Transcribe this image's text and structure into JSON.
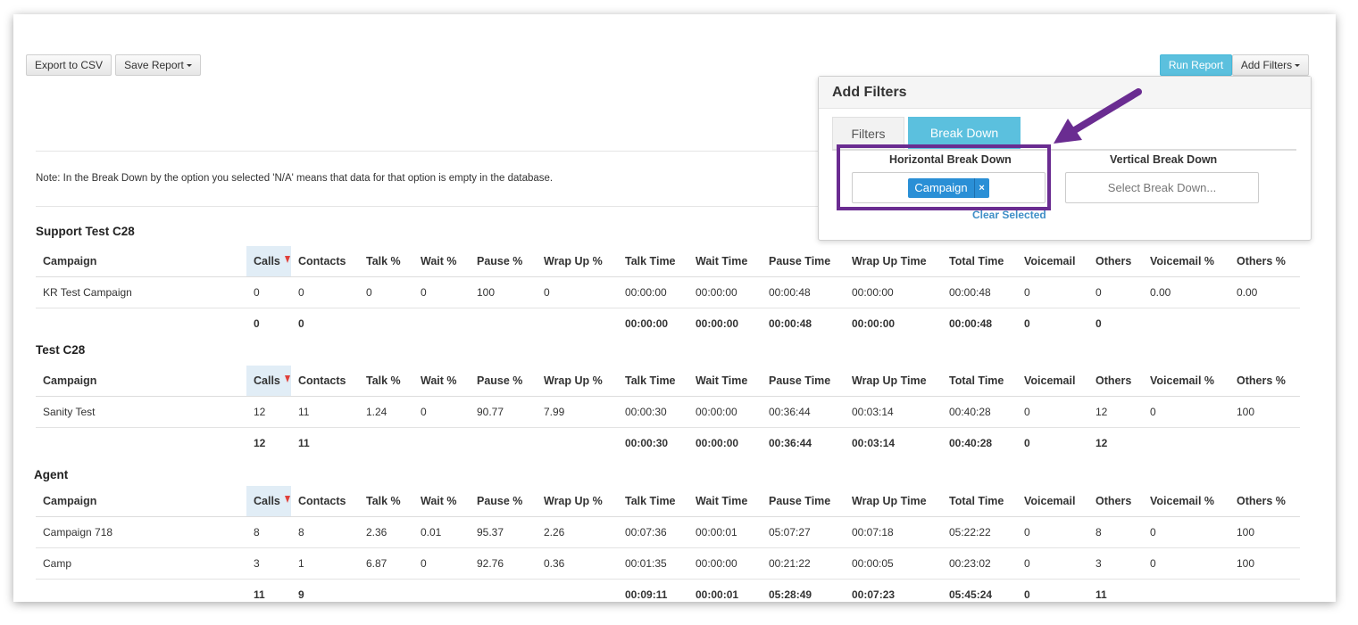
{
  "toolbar": {
    "export_label": "Export to CSV",
    "save_label": "Save Report",
    "run_label": "Run Report",
    "add_filters_label": "Add Filters"
  },
  "note": "Note: In the Break Down by the option you selected 'N/A' means that data for that option is empty in the database.",
  "columns": [
    "Campaign",
    "Calls",
    "Contacts",
    "Talk %",
    "Wait %",
    "Pause %",
    "Wrap Up %",
    "Talk Time",
    "Wait Time",
    "Pause Time",
    "Wrap Up Time",
    "Total Time",
    "Voicemail",
    "Others",
    "Voicemail %",
    "Others %"
  ],
  "sections": [
    {
      "title": "Support Test C28",
      "rows": [
        {
          "campaign": "KR Test Campaign",
          "calls": "0",
          "contacts": "0",
          "talk_pct": "0",
          "wait_pct": "0",
          "pause_pct": "100",
          "wrapup_pct": "0",
          "talk_time": "00:00:00",
          "wait_time": "00:00:00",
          "pause_time": "00:00:48",
          "wrapup_time": "00:00:00",
          "total_time": "00:00:48",
          "voicemail": "0",
          "others": "0",
          "voicemail_pct": "0.00",
          "others_pct": "0.00"
        }
      ],
      "totals": {
        "calls": "0",
        "contacts": "0",
        "talk_time": "00:00:00",
        "wait_time": "00:00:00",
        "pause_time": "00:00:48",
        "wrapup_time": "00:00:00",
        "total_time": "00:00:48",
        "voicemail": "0",
        "others": "0"
      }
    },
    {
      "title": "Test C28",
      "rows": [
        {
          "campaign": "Sanity Test",
          "calls": "12",
          "contacts": "11",
          "talk_pct": "1.24",
          "wait_pct": "0",
          "pause_pct": "90.77",
          "wrapup_pct": "7.99",
          "talk_time": "00:00:30",
          "wait_time": "00:00:00",
          "pause_time": "00:36:44",
          "wrapup_time": "00:03:14",
          "total_time": "00:40:28",
          "voicemail": "0",
          "others": "12",
          "voicemail_pct": "0",
          "others_pct": "100"
        }
      ],
      "totals": {
        "calls": "12",
        "contacts": "11",
        "talk_time": "00:00:30",
        "wait_time": "00:00:00",
        "pause_time": "00:36:44",
        "wrapup_time": "00:03:14",
        "total_time": "00:40:28",
        "voicemail": "0",
        "others": "12"
      }
    },
    {
      "title": "Agent",
      "rows": [
        {
          "campaign": "Campaign 718",
          "calls": "8",
          "contacts": "8",
          "talk_pct": "2.36",
          "wait_pct": "0.01",
          "pause_pct": "95.37",
          "wrapup_pct": "2.26",
          "talk_time": "00:07:36",
          "wait_time": "00:00:01",
          "pause_time": "05:07:27",
          "wrapup_time": "00:07:18",
          "total_time": "05:22:22",
          "voicemail": "0",
          "others": "8",
          "voicemail_pct": "0",
          "others_pct": "100"
        },
        {
          "campaign": "Camp",
          "calls": "3",
          "contacts": "1",
          "talk_pct": "6.87",
          "wait_pct": "0",
          "pause_pct": "92.76",
          "wrapup_pct": "0.36",
          "talk_time": "00:01:35",
          "wait_time": "00:00:00",
          "pause_time": "00:21:22",
          "wrapup_time": "00:00:05",
          "total_time": "00:23:02",
          "voicemail": "0",
          "others": "3",
          "voicemail_pct": "0",
          "others_pct": "100"
        }
      ],
      "totals": {
        "calls": "11",
        "contacts": "9",
        "talk_time": "00:09:11",
        "wait_time": "00:00:01",
        "pause_time": "05:28:49",
        "wrapup_time": "00:07:23",
        "total_time": "05:45:24",
        "voicemail": "0",
        "others": "11"
      }
    }
  ],
  "filters_panel": {
    "title": "Add Filters",
    "tabs": [
      "Filters",
      "Break Down"
    ],
    "active_tab": "Break Down",
    "horizontal_label": "Horizontal Break Down",
    "vertical_label": "Vertical Break Down",
    "horizontal_chip": "Campaign",
    "chip_remove": "×",
    "vertical_placeholder": "Select Break Down...",
    "clear_label": "Clear Selected"
  },
  "annotation_color": "#6a2c91",
  "accent_color": "#5bc0de"
}
